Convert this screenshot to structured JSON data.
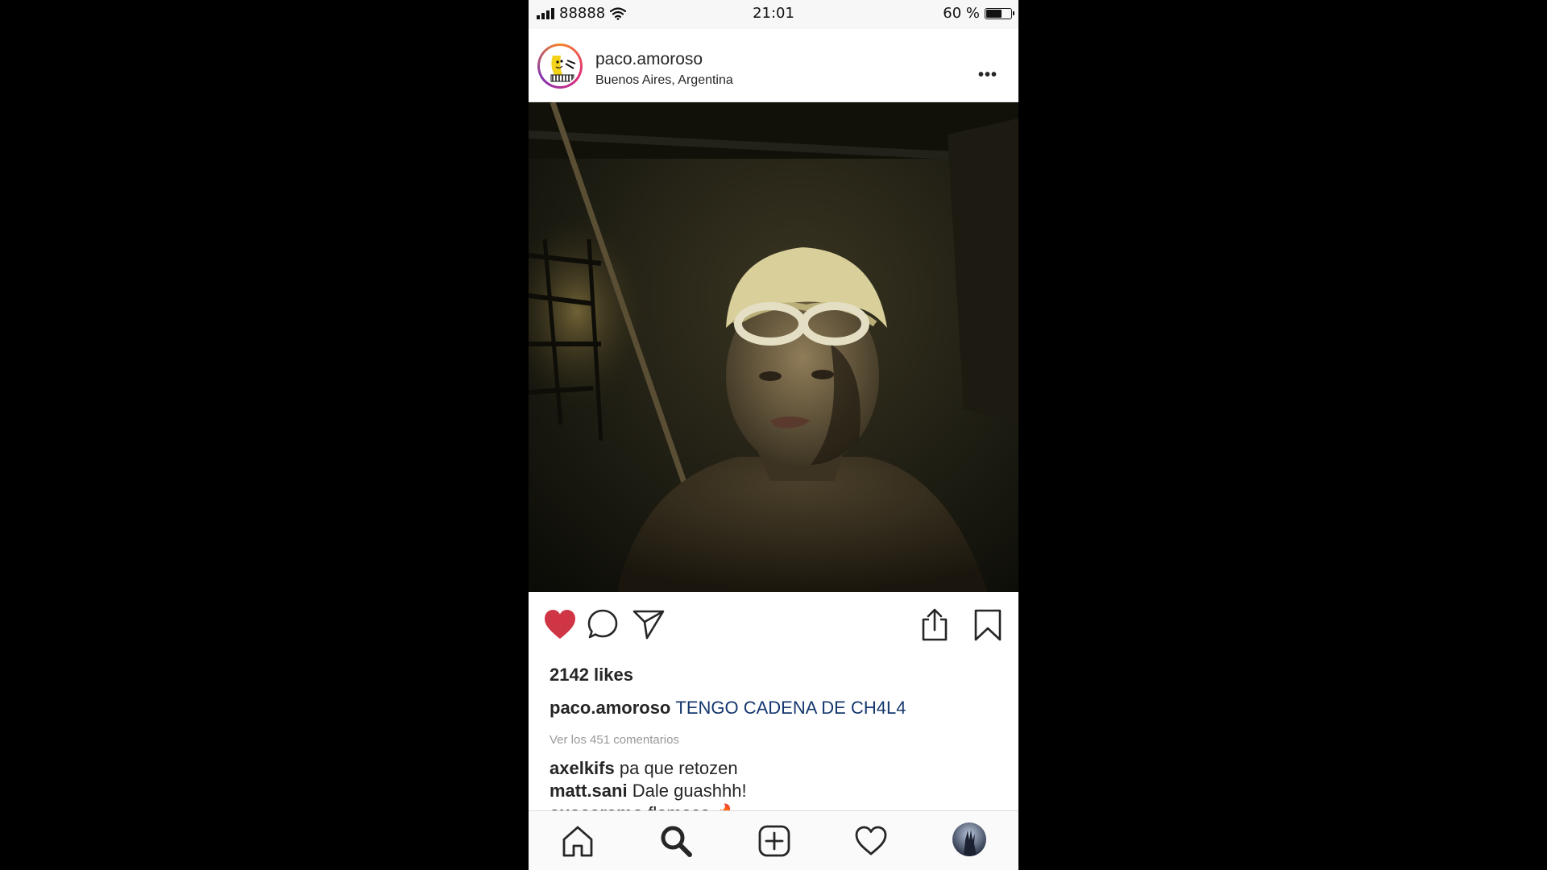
{
  "status_bar": {
    "carrier": "88888",
    "time": "21:01",
    "battery": "60 %",
    "battery_level": 0.6,
    "icons": [
      "signal-icon",
      "wifi-icon",
      "battery-icon"
    ]
  },
  "post": {
    "username": "paco.amoroso",
    "location": "Buenos Aires, Argentina",
    "more_label": "•••",
    "liked": true,
    "likes": "2142 likes",
    "caption": {
      "username": "paco.amoroso",
      "text": "TENGO CADENA DE CH4L4"
    },
    "view_comments": "Ver los 451 comentarios",
    "comments": [
      {
        "username": "axelkifs",
        "text": "pa que retozen"
      },
      {
        "username": "matt.sani",
        "text": "Dale guashhh!"
      },
      {
        "username": "cuscaramo",
        "text": "flamaso 🔥"
      }
    ],
    "actions": [
      "heart-icon",
      "comment-icon",
      "send-icon",
      "share-icon",
      "bookmark-icon"
    ]
  },
  "tab_bar": {
    "tabs": [
      "home-icon",
      "search-icon",
      "new-post-icon",
      "activity-icon",
      "profile-icon"
    ]
  },
  "colors": {
    "like_red": "#d03546",
    "caption_blue": "#14376e",
    "story_ring": "#dd2a7b"
  }
}
